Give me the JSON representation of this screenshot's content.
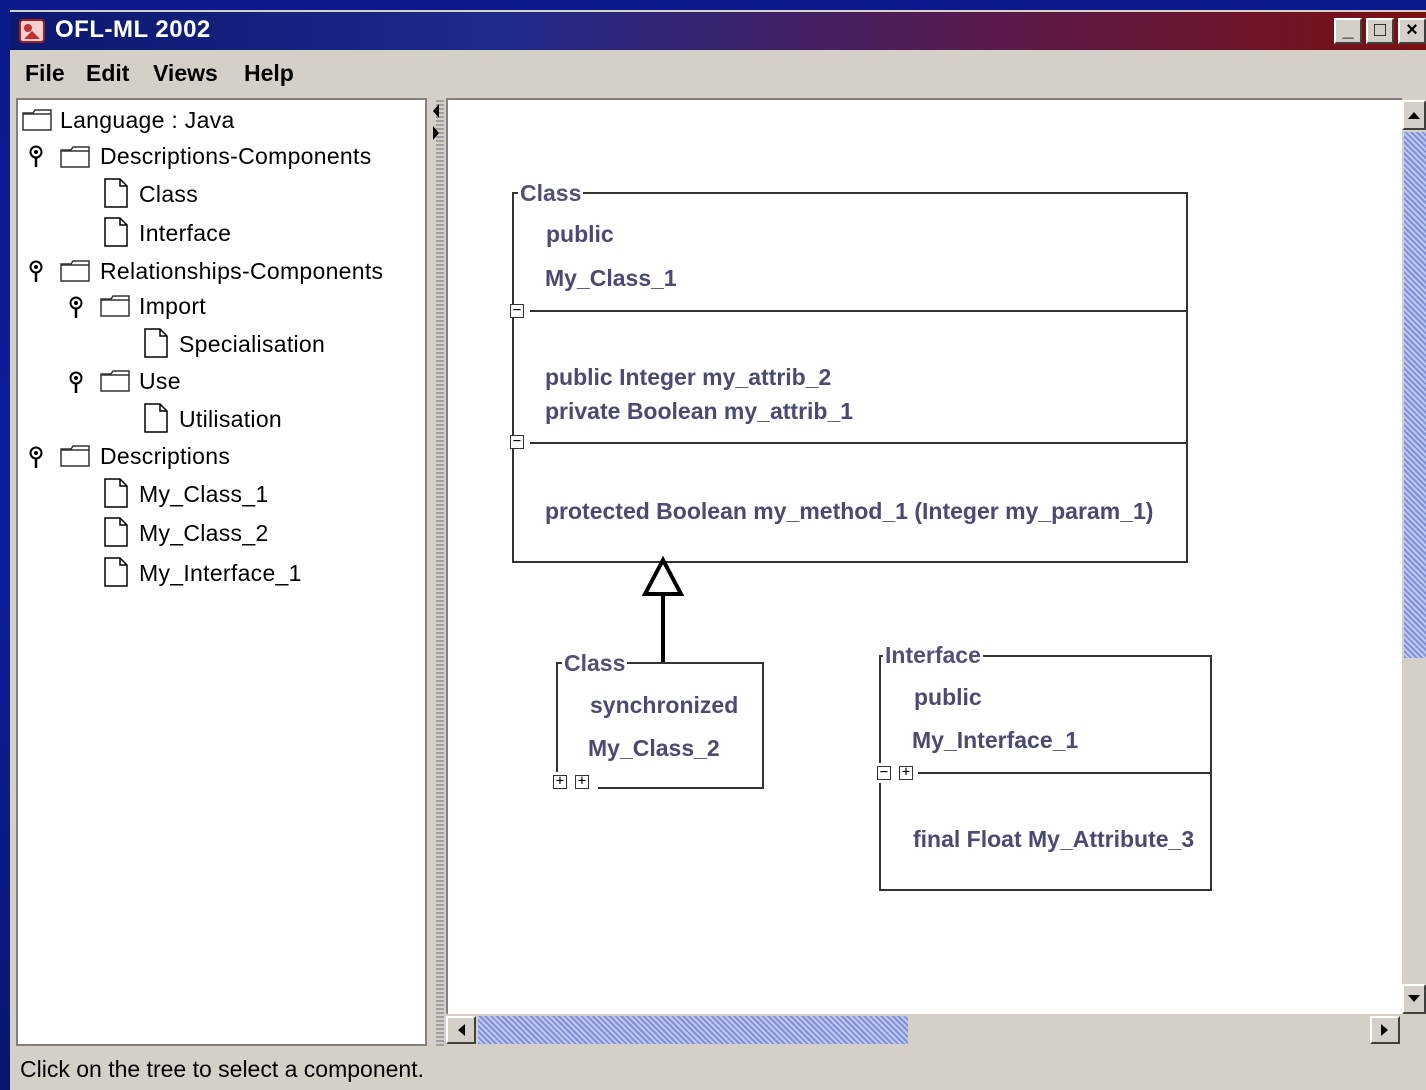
{
  "window": {
    "title": "OFL-ML 2002",
    "controls": {
      "minimize": "_",
      "maximize": "□",
      "close": "×"
    }
  },
  "menu": [
    "File",
    "Edit",
    "Views",
    "Help"
  ],
  "tree": {
    "root": "Language : Java",
    "items": [
      {
        "label": "Descriptions-Components",
        "type": "folder"
      },
      {
        "label": "Class",
        "type": "doc"
      },
      {
        "label": "Interface",
        "type": "doc"
      },
      {
        "label": "Relationships-Components",
        "type": "folder"
      },
      {
        "label": "Import",
        "type": "folder"
      },
      {
        "label": "Specialisation",
        "type": "doc"
      },
      {
        "label": "Use",
        "type": "folder"
      },
      {
        "label": "Utilisation",
        "type": "doc"
      },
      {
        "label": "Descriptions",
        "type": "folder"
      },
      {
        "label": "My_Class_1",
        "type": "doc"
      },
      {
        "label": "My_Class_2",
        "type": "doc"
      },
      {
        "label": "My_Interface_1",
        "type": "doc"
      }
    ]
  },
  "diagram": {
    "class1": {
      "kind": "Class",
      "visibility": "public",
      "name": "My_Class_1",
      "attributes": [
        "public Integer my_attrib_2",
        "private Boolean my_attrib_1"
      ],
      "methods": [
        "protected Boolean my_method_1 (Integer my_param_1)"
      ]
    },
    "class2": {
      "kind": "Class",
      "modifier": "synchronized",
      "name": "My_Class_2"
    },
    "interface1": {
      "kind": "Interface",
      "visibility": "public",
      "name": "My_Interface_1",
      "attributes": [
        "final Float My_Attribute_3"
      ]
    },
    "toggles": {
      "collapse": "−",
      "expand": "+"
    }
  },
  "status": "Click on the tree to select a component.",
  "colors": {
    "title_start": "#0a1870",
    "title_end": "#7a1010",
    "diagram_text": "#4a4a72",
    "scroll_thumb": "#8090d8"
  },
  "icons": [
    "app-icon",
    "folder-icon",
    "document-icon",
    "pin-icon",
    "scroll-up-icon",
    "scroll-down-icon",
    "scroll-left-icon",
    "scroll-right-icon"
  ]
}
